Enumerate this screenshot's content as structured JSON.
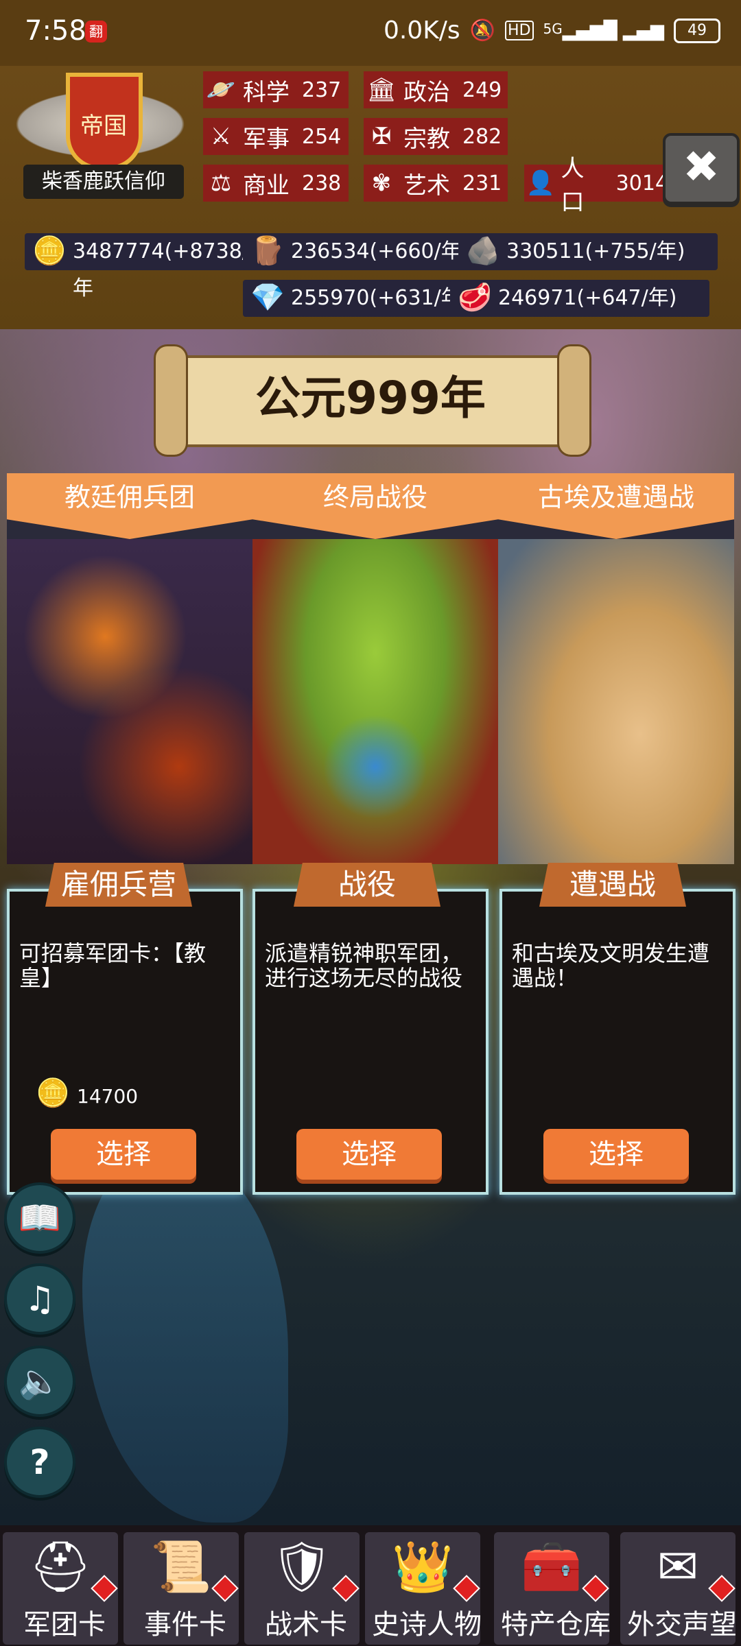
{
  "status_bar": {
    "time": "7:58",
    "badge": "翻",
    "network_speed": "0.0K/s",
    "hd": "HD",
    "network": "5G",
    "battery": "49"
  },
  "empire": {
    "emblem_text": "帝国",
    "name": "柴香鹿跃信仰"
  },
  "stats": [
    {
      "label": "科学",
      "value": "237",
      "icon": "science-icon"
    },
    {
      "label": "政治",
      "value": "249",
      "icon": "politics-icon"
    },
    {
      "label": "军事",
      "value": "254",
      "icon": "military-icon"
    },
    {
      "label": "宗教",
      "value": "282",
      "icon": "religion-icon"
    },
    {
      "label": "商业",
      "value": "238",
      "icon": "commerce-icon"
    },
    {
      "label": "艺术",
      "value": "231",
      "icon": "art-icon"
    },
    {
      "label": "人口",
      "value": "3014",
      "icon": "population-icon"
    }
  ],
  "resources": [
    {
      "text": "3487774(+8738/年",
      "icon": "gold-icon"
    },
    {
      "text": "236534(+660/年)",
      "icon": "wood-icon"
    },
    {
      "text": "330511(+755/年)",
      "icon": "stone-icon"
    },
    {
      "text": "255970(+631/年",
      "icon": "crystal-icon"
    },
    {
      "text": "246971(+647/年)",
      "icon": "meat-icon"
    }
  ],
  "year_banner": "公元999年",
  "cards": [
    {
      "tab": "教廷佣兵团",
      "ribbon": "雇佣兵营",
      "description": "可招募军团卡：【教皇】",
      "cost": "14700",
      "button": "选择"
    },
    {
      "tab": "终局战役",
      "ribbon": "战役",
      "description": "派遣精锐神职军团，进行这场无尽的战役",
      "cost": "",
      "button": "选择"
    },
    {
      "tab": "古埃及遭遇战",
      "ribbon": "遭遇战",
      "description": "和古埃及文明发生遭遇战！",
      "cost": "",
      "button": "选择"
    }
  ],
  "side_buttons": [
    "notes-icon",
    "music-icon",
    "sound-icon",
    "help-icon"
  ],
  "nav": [
    {
      "label": "军团卡",
      "icon": "helmet-icon"
    },
    {
      "label": "事件卡",
      "icon": "scroll-icon"
    },
    {
      "label": "战术卡",
      "icon": "shield-icon"
    },
    {
      "label": "史诗人物",
      "icon": "crown-icon"
    },
    {
      "label": "特产仓库",
      "icon": "chest-icon"
    },
    {
      "label": "外交声望",
      "icon": "envelope-icon"
    }
  ],
  "colors": {
    "header_bg": "#6b4a18",
    "stat_bg": "#8c1e1a",
    "card_tab": "#f29a52",
    "select_button": "#f07a36",
    "card_border": "#b8e0e0"
  }
}
